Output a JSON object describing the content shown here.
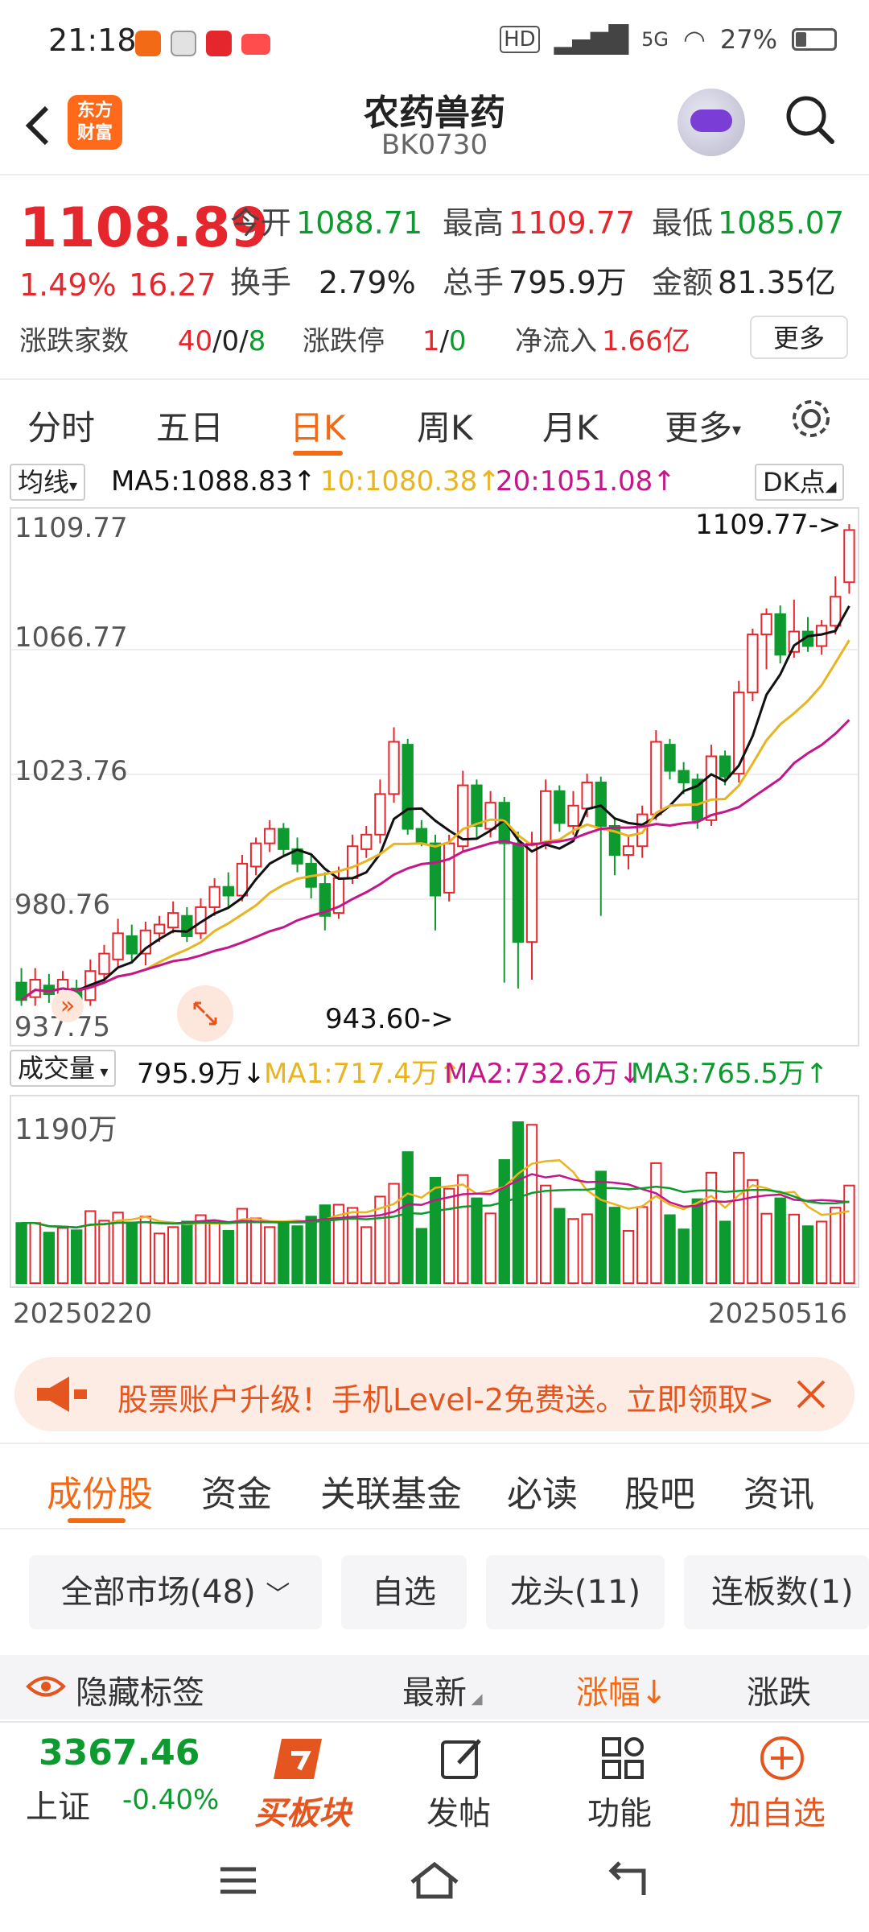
{
  "status": {
    "time": "21:18",
    "battery": "27%",
    "network": "5G"
  },
  "header": {
    "back": "<",
    "logo_line1": "东方",
    "logo_line2": "财富",
    "title": "农药兽药",
    "code": "BK0730"
  },
  "quote": {
    "price": "1108.89",
    "change_pct": "1.49%",
    "change": "16.27",
    "open_label": "今开",
    "open": "1088.71",
    "high_label": "最高",
    "high": "1109.77",
    "low_label": "最低",
    "low": "1085.07",
    "turnover_label": "换手",
    "turnover": "2.79%",
    "volume_label": "总手",
    "volume": "795.9万",
    "amount_label": "金额",
    "amount": "81.35亿",
    "updown_label": "涨跌家数",
    "up": "40",
    "sep1": "/",
    "flat": "0",
    "sep2": "/",
    "down": "8",
    "limit_label": "涨跌停",
    "limit_up": "1",
    "sep3": "/",
    "limit_down": "0",
    "inflow_label": "净流入",
    "inflow": "1.66亿",
    "more": "更多"
  },
  "tabs": [
    "分时",
    "五日",
    "日K",
    "周K",
    "月K",
    "更多"
  ],
  "ma": {
    "selector": "均线",
    "ma5": "MA5:1088.83",
    "ma10": "10:1080.38",
    "ma20": "20:1051.08",
    "dk": "DK点"
  },
  "price_axis": [
    "1109.77",
    "1066.77",
    "1023.76",
    "980.76",
    "937.75"
  ],
  "annotations": {
    "high": "1109.77->",
    "low": "943.60->"
  },
  "volume": {
    "selector": "成交量",
    "vol": "795.9万",
    "ma1": "MA1:717.4万",
    "ma2": "MA2:732.6万",
    "ma3": "MA3:765.5万",
    "axis": "1190万"
  },
  "dates": {
    "start": "20250220",
    "end": "20250516"
  },
  "banner": {
    "text": "股票账户升级！手机Level-2免费送。立即领取>"
  },
  "subtabs": [
    "成份股",
    "资金",
    "关联基金",
    "必读",
    "股吧",
    "资讯"
  ],
  "filters": [
    "全部市场(48)",
    "自选",
    "龙头(11)",
    "连板数(1)"
  ],
  "columns": {
    "hide": "隐藏标签",
    "latest": "最新",
    "change": "涨幅",
    "updown": "涨跌"
  },
  "bottom": {
    "index_value": "3367.46",
    "index_name": "上证",
    "index_change": "-0.40%",
    "buy": "买板块",
    "post": "发帖",
    "func": "功能",
    "add": "加自选"
  },
  "colors": {
    "up": "#e5262d",
    "down": "#0d9a2e",
    "accent": "#f26a16",
    "ma5": "#111111",
    "ma10": "#e8b420",
    "ma20": "#c4168a"
  },
  "chart_data": {
    "type": "candlestick",
    "dates_range": [
      "20250220",
      "20250516"
    ],
    "ylim": [
      937.75,
      1109.77
    ],
    "candles": [
      [
        952,
        946,
        957,
        944
      ],
      [
        947,
        953,
        957,
        944
      ],
      [
        951,
        948,
        955,
        945
      ],
      [
        948,
        953,
        956,
        946
      ],
      [
        950,
        946,
        953,
        943
      ],
      [
        946,
        956,
        960,
        944
      ],
      [
        955,
        962,
        965,
        952
      ],
      [
        960,
        969,
        974,
        957
      ],
      [
        968,
        962,
        972,
        959
      ],
      [
        962,
        970,
        973,
        958
      ],
      [
        969,
        972,
        975,
        966
      ],
      [
        971,
        976,
        980,
        969
      ],
      [
        975,
        968,
        978,
        966
      ],
      [
        969,
        978,
        981,
        967
      ],
      [
        978,
        985,
        988,
        975
      ],
      [
        985,
        982,
        990,
        978
      ],
      [
        982,
        993,
        996,
        980
      ],
      [
        992,
        1000,
        1002,
        989
      ],
      [
        1000,
        1005,
        1008,
        997
      ],
      [
        1005,
        998,
        1007,
        996
      ],
      [
        998,
        993,
        1002,
        990
      ],
      [
        993,
        985,
        996,
        981
      ],
      [
        986,
        975,
        990,
        970
      ],
      [
        976,
        988,
        992,
        974
      ],
      [
        988,
        999,
        1003,
        986
      ],
      [
        998,
        1003,
        1006,
        995
      ],
      [
        1003,
        1017,
        1022,
        1000
      ],
      [
        1017,
        1035,
        1040,
        1014
      ],
      [
        1034,
        1005,
        1036,
        1003
      ],
      [
        1005,
        1000,
        1008,
        999
      ],
      [
        1000,
        982,
        1003,
        970
      ],
      [
        983,
        1000,
        1003,
        980
      ],
      [
        999,
        1020,
        1025,
        997
      ],
      [
        1020,
        1006,
        1022,
        1002
      ],
      [
        1005,
        1014,
        1018,
        1002
      ],
      [
        1014,
        1000,
        1016,
        952
      ],
      [
        1000,
        966,
        1004,
        950
      ],
      [
        966,
        1000,
        1004,
        953
      ],
      [
        1000,
        1018,
        1022,
        998
      ],
      [
        1018,
        1007,
        1020,
        1004
      ],
      [
        1006,
        1013,
        1018,
        1003
      ],
      [
        1012,
        1021,
        1024,
        1009
      ],
      [
        1021,
        1006,
        1023,
        975
      ],
      [
        1006,
        996,
        1009,
        989
      ],
      [
        996,
        999,
        1003,
        991
      ],
      [
        999,
        1010,
        1013,
        995
      ],
      [
        1010,
        1035,
        1039,
        1008
      ],
      [
        1034,
        1025,
        1036,
        1022
      ],
      [
        1025,
        1021,
        1028,
        1017
      ],
      [
        1022,
        1008,
        1024,
        1005
      ],
      [
        1008,
        1030,
        1034,
        1006
      ],
      [
        1030,
        1023,
        1032,
        1020
      ],
      [
        1024,
        1052,
        1056,
        1021
      ],
      [
        1052,
        1072,
        1074,
        1049
      ],
      [
        1072,
        1079,
        1081,
        1060
      ],
      [
        1079,
        1065,
        1082,
        1062
      ],
      [
        1066,
        1073,
        1084,
        1064
      ],
      [
        1073,
        1068,
        1078,
        1066
      ],
      [
        1068,
        1075,
        1077,
        1065
      ],
      [
        1075,
        1085,
        1092,
        1072
      ],
      [
        1090,
        1108,
        1110,
        1086
      ]
    ],
    "volume_ticks": [
      "1190万"
    ]
  }
}
